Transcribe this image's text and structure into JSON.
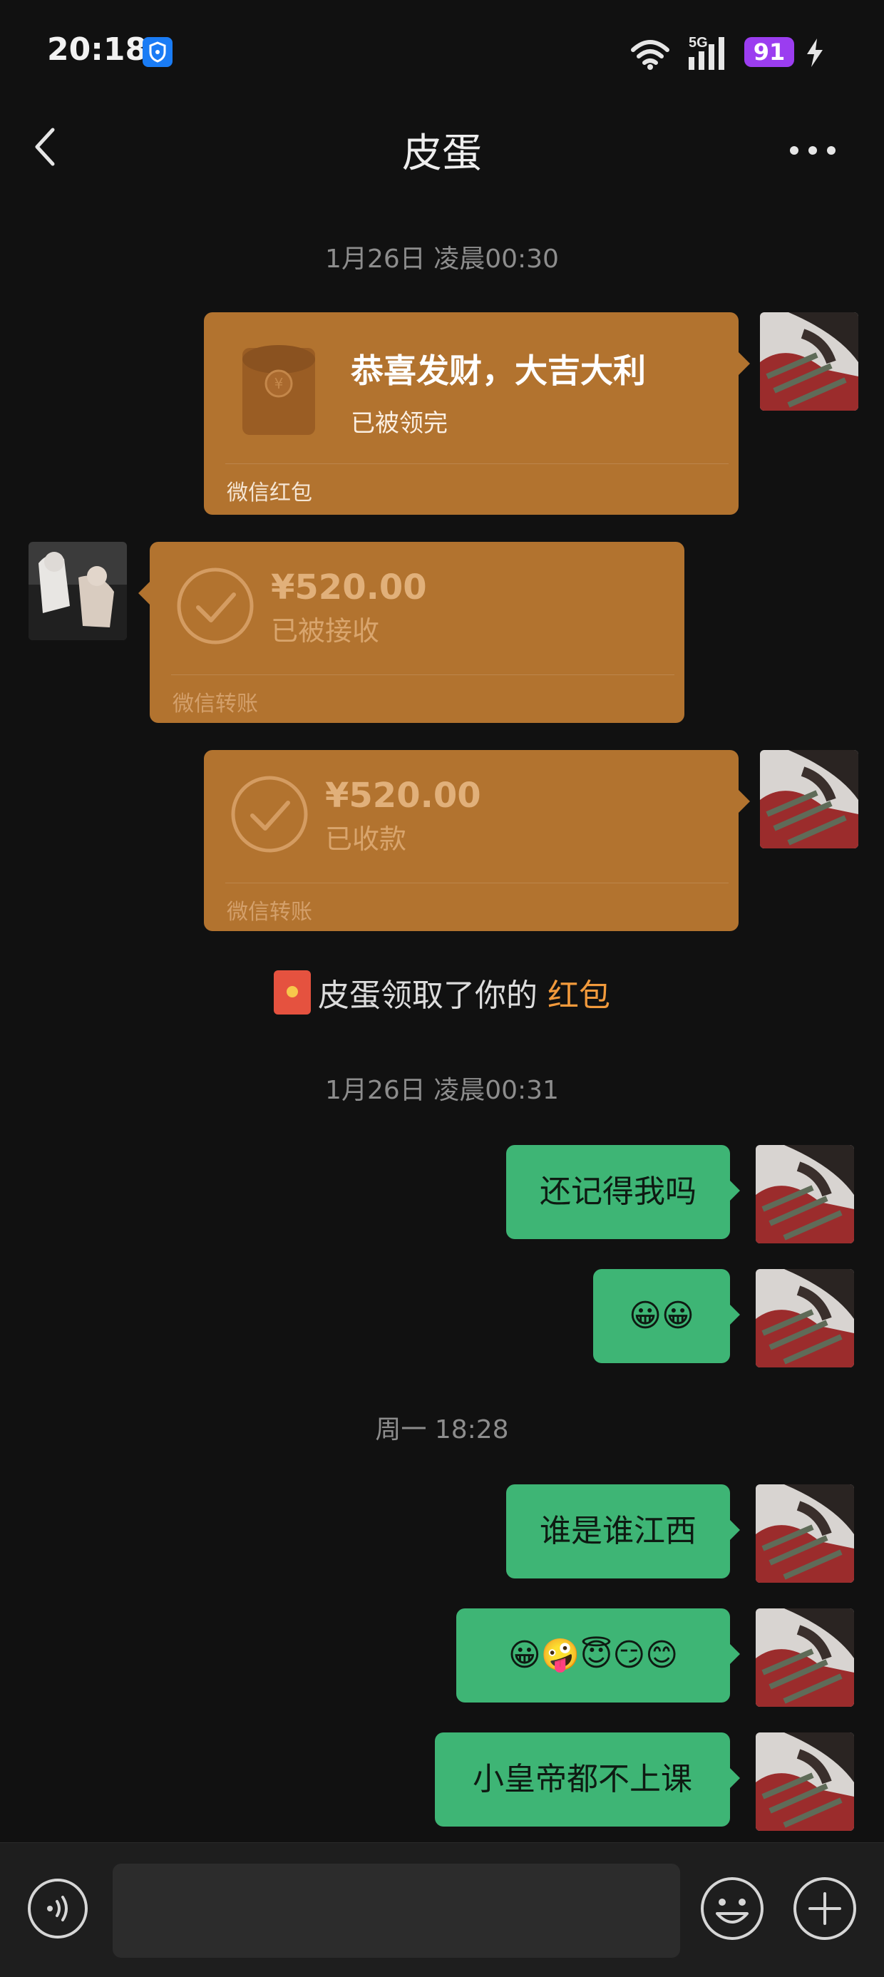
{
  "status_bar": {
    "time": "20:18",
    "network": "5G",
    "battery": "91",
    "icons": [
      "shield-icon",
      "wifi-icon",
      "signal-icon",
      "battery-icon",
      "charging-icon"
    ]
  },
  "header": {
    "title": "皮蛋",
    "back_icon": "chevron-left-icon",
    "more_icon": "more-icon"
  },
  "messages": {
    "ts1": "1月26日 凌晨00:30",
    "red_packet": {
      "title": "恭喜发财，大吉大利",
      "status": "已被领完",
      "footer": "微信红包"
    },
    "transfer1": {
      "amount": "¥520.00",
      "status": "已被接收",
      "footer": "微信转账"
    },
    "transfer2": {
      "amount": "¥520.00",
      "status": "已收款",
      "footer": "微信转账"
    },
    "system": {
      "prefix": "皮蛋领取了你的 ",
      "link": "红包"
    },
    "ts2": "1月26日 凌晨00:31",
    "m1": "还记得我吗",
    "m2": "😀😀",
    "ts3": "周一 18:28",
    "m3": "谁是谁江西",
    "m4": "😀🤪😇😏😊",
    "m5": "小皇帝都不上课"
  },
  "input_bar": {
    "voice_icon": "voice-icon",
    "input_value": "",
    "emoji_icon": "emoji-icon",
    "plus_icon": "plus-icon"
  },
  "colors": {
    "background": "#111111",
    "green_bubble": "#3eb575",
    "orange_card": "#b2732f",
    "red_packet_link": "#f29a3c",
    "battery": "#9b3df0"
  }
}
